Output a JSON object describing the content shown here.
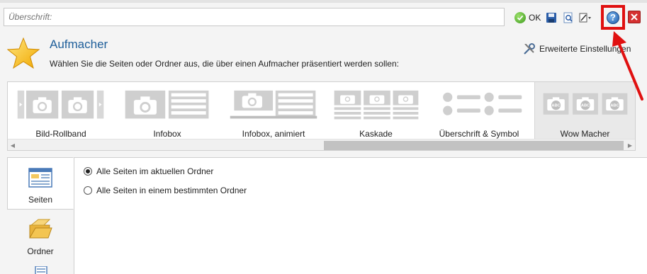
{
  "header": {
    "title_placeholder": "Überschrift:",
    "ok_label": "OK",
    "icons": [
      "ok-icon",
      "save-icon",
      "preview-icon",
      "edit-icon",
      "help-icon",
      "close-icon"
    ]
  },
  "module": {
    "name": "Aufmacher",
    "description": "Wählen Sie die Seiten oder Ordner aus, die über einen Aufmacher präsentiert werden sollen:",
    "advanced_settings_label": "Erweiterte Einstellungen"
  },
  "gallery": {
    "items": [
      {
        "label": "Bild-Rollband"
      },
      {
        "label": "Infobox"
      },
      {
        "label": "Infobox, animiert"
      },
      {
        "label": "Kaskade"
      },
      {
        "label": "Überschrift & Symbol"
      },
      {
        "label": "Wow Macher",
        "selected": true
      }
    ]
  },
  "side_tabs": [
    {
      "label": "Seiten",
      "active": true
    },
    {
      "label": "Ordner"
    }
  ],
  "options": [
    {
      "label": "Alle Seiten im aktuellen Ordner",
      "checked": true
    },
    {
      "label": "Alle Seiten in einem bestimmten Ordner",
      "checked": false
    }
  ],
  "colors": {
    "heading": "#1f5f9a",
    "highlight_box": "#e01010",
    "ok_green": "#3d9a1e",
    "close_red": "#d53131"
  }
}
